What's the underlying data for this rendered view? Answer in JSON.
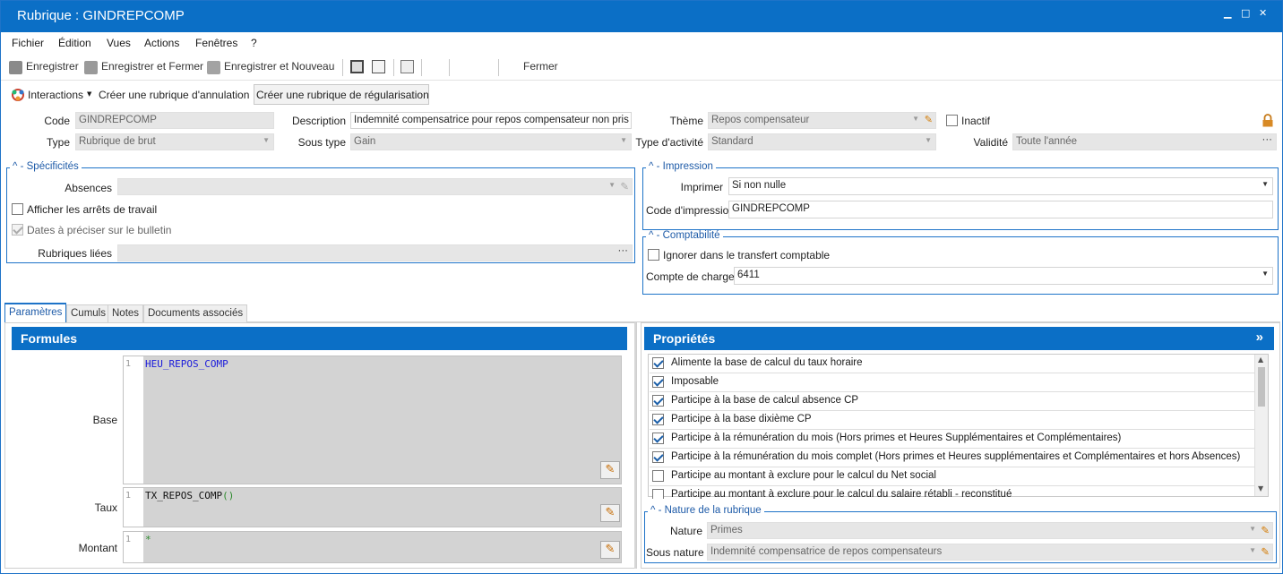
{
  "window": {
    "title": "Rubrique : GINDREPCOMP",
    "minimize": "▁",
    "maximize": "□",
    "close": "✕"
  },
  "menu": {
    "items": [
      "Fichier",
      "Édition",
      "Vues",
      "Actions",
      "Fenêtres",
      "?"
    ]
  },
  "toolbar": {
    "save": "Enregistrer",
    "save_close": "Enregistrer et Fermer",
    "save_new": "Enregistrer et Nouveau",
    "close": "Fermer"
  },
  "actions": {
    "interactions": "Interactions",
    "cancel_rubric": "Créer une rubrique d'annulation",
    "regul_rubric": "Créer une rubrique de régularisation"
  },
  "form": {
    "code_label": "Code",
    "code": "GINDREPCOMP",
    "type_label": "Type",
    "type": "Rubrique de brut",
    "desc_label": "Description",
    "desc": "Indemnité compensatrice pour repos compensateur non pris",
    "subtype_label": "Sous type",
    "subtype": "Gain",
    "theme_label": "Thème",
    "theme": "Repos compensateur",
    "activity_label": "Type d'activité",
    "activity": "Standard",
    "inactive_label": "Inactif",
    "validity_label": "Validité",
    "validity": "Toute l'année"
  },
  "specificites": {
    "title": "Spécificités",
    "absences_label": "Absences",
    "absences": "",
    "show_stops": "Afficher les arrêts de travail",
    "dates_bulletin": "Dates à préciser sur le bulletin",
    "linked_label": "Rubriques liées",
    "linked": ""
  },
  "impression": {
    "title": "Impression",
    "print_label": "Imprimer",
    "print": "Si non nulle",
    "code_label": "Code d'impression",
    "code": "GINDREPCOMP"
  },
  "comptabilite": {
    "title": "Comptabilité",
    "ignore": "Ignorer dans le transfert comptable",
    "account_label": "Compte de charges",
    "account": "6411"
  },
  "tabs": [
    "Paramètres",
    "Cumuls",
    "Notes",
    "Documents associés"
  ],
  "formules": {
    "title": "Formules",
    "base_label": "Base",
    "base_line": "1",
    "base": "HEU_REPOS_COMP",
    "taux_label": "Taux",
    "taux_line": "1",
    "taux_name": "TX_REPOS_COMP",
    "taux_paren": "()",
    "montant_label": "Montant",
    "montant_line": "1",
    "montant": "*"
  },
  "proprietes": {
    "title": "Propriétés",
    "expand": "»",
    "items": [
      {
        "label": "Alimente la base de calcul du taux horaire",
        "checked": true
      },
      {
        "label": "Imposable",
        "checked": true
      },
      {
        "label": "Participe à la base de calcul absence CP",
        "checked": true
      },
      {
        "label": "Participe à la base dixième CP",
        "checked": true
      },
      {
        "label": "Participe à la rémunération du mois (Hors primes et Heures Supplémentaires et Complémentaires)",
        "checked": true
      },
      {
        "label": "Participe à la rémunération du mois complet (Hors primes et Heures supplémentaires et Complémentaires et hors Absences)",
        "checked": true
      },
      {
        "label": "Participe au montant à exclure pour le calcul du Net social",
        "checked": false
      },
      {
        "label": "Participe au montant à exclure pour le calcul du salaire rétabli - reconstitué",
        "checked": false
      }
    ]
  },
  "nature": {
    "title": "Nature de la rubrique",
    "nature_label": "Nature",
    "nature": "Primes",
    "subnature_label": "Sous nature",
    "subnature": "Indemnité compensatrice de repos compensateurs"
  },
  "colors": {
    "accent": "#0b6fc6",
    "group_border": "#1e73c8",
    "code_blue": "#1a1adb",
    "code_green": "#2d8a2d"
  }
}
